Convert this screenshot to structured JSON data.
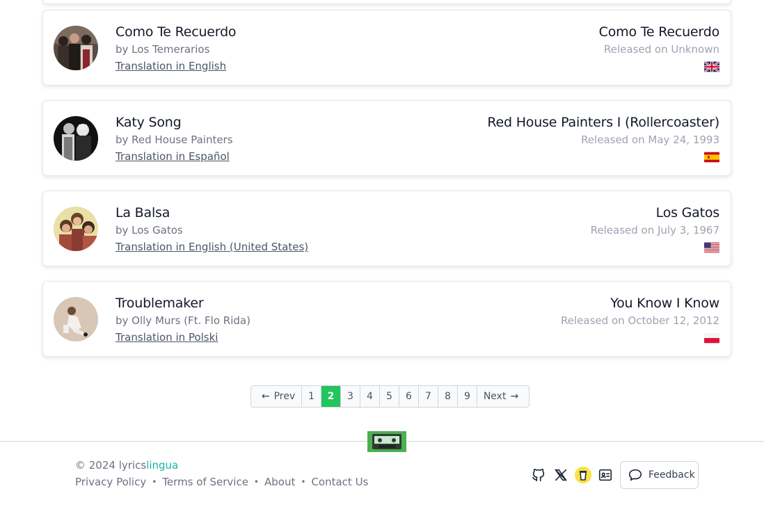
{
  "songs": [
    {
      "title": "Como Te Recuerdo",
      "artist": "by Los Temerarios",
      "translation": "Translation in English",
      "album": "Como Te Recuerdo",
      "released": "Released on Unknown",
      "flag_icon": "uk-flag-icon"
    },
    {
      "title": "Katy Song",
      "artist": "by Red House Painters",
      "translation": "Translation in Español",
      "album": "Red House Painters I (Rollercoaster)",
      "released": "Released on May 24, 1993",
      "flag_icon": "spain-flag-icon"
    },
    {
      "title": "La Balsa",
      "artist": "by Los Gatos",
      "translation": "Translation in English (United States)",
      "album": "Los Gatos",
      "released": "Released on July 3, 1967",
      "flag_icon": "usa-flag-icon"
    },
    {
      "title": "Troublemaker",
      "artist": "by Olly Murs (Ft. Flo Rida)",
      "translation": "Translation in Polski",
      "album": "You Know I Know",
      "released": "Released on October 12, 2012",
      "flag_icon": "poland-flag-icon"
    }
  ],
  "pagination": {
    "prev_label": "Prev",
    "next_label": "Next",
    "pages": [
      "1",
      "2",
      "3",
      "4",
      "5",
      "6",
      "7",
      "8",
      "9"
    ],
    "current": "2"
  },
  "footer": {
    "copyright_prefix": "© 2024 lyrics",
    "brand_suffix": "lingua",
    "links": [
      "Privacy Policy",
      "Terms of Service",
      "About",
      "Contact Us"
    ],
    "feedback_label": "Feedback",
    "social_icons": [
      "github-icon",
      "x-icon",
      "buymeacoffee-icon",
      "id-card-icon"
    ]
  },
  "colors": {
    "accent": "#22c55e",
    "brand": "#14b8a6"
  }
}
